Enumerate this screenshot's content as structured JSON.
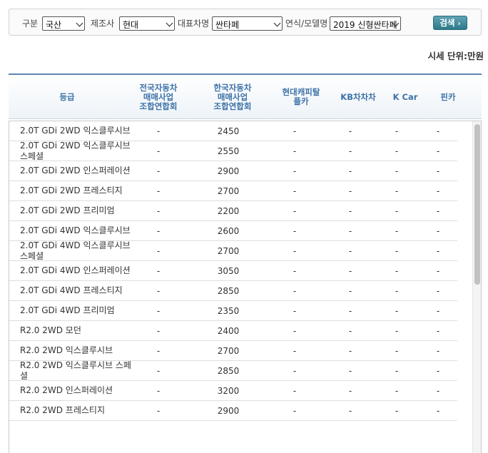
{
  "filters": {
    "category_label": "구분",
    "category_value": "국산",
    "maker_label": "제조사",
    "maker_value": "현대",
    "model_label": "대표차명",
    "model_value": "싼타페",
    "year_label": "연식/모델명",
    "year_value": "2019 신형싼타페",
    "search_label": "검색",
    "search_icon": "chevron-right-icon"
  },
  "unit_note": "시세 단위:만원",
  "columns": {
    "grade": "등급",
    "c1": [
      "전국자동차",
      "매매사업",
      "조합연합회"
    ],
    "c2": [
      "한국자동차",
      "매매사업",
      "조합연합회"
    ],
    "c3": [
      "현대캐피탈",
      "플카"
    ],
    "c4": "KB차차차",
    "c5": "K Car",
    "c6": "핀카"
  },
  "accent_color": "#3d72a8",
  "rows": [
    {
      "grade": "2.0T GDi 2WD 익스클루시브",
      "v": [
        "-",
        "2450",
        "-",
        "-",
        "-",
        "-"
      ]
    },
    {
      "grade": "2.0T GDi 2WD 익스클루시브 스페셜",
      "v": [
        "-",
        "2550",
        "-",
        "-",
        "-",
        "-"
      ]
    },
    {
      "grade": "2.0T GDi 2WD 인스퍼레이션",
      "v": [
        "-",
        "2900",
        "-",
        "-",
        "-",
        "-"
      ]
    },
    {
      "grade": "2.0T GDi 2WD 프레스티지",
      "v": [
        "-",
        "2700",
        "-",
        "-",
        "-",
        "-"
      ]
    },
    {
      "grade": "2.0T GDi 2WD 프리미엄",
      "v": [
        "-",
        "2200",
        "-",
        "-",
        "-",
        "-"
      ]
    },
    {
      "grade": "2.0T GDi 4WD 익스클루시브",
      "v": [
        "-",
        "2600",
        "-",
        "-",
        "-",
        "-"
      ]
    },
    {
      "grade": "2.0T GDi 4WD 익스클루시브 스페셜",
      "v": [
        "-",
        "2700",
        "-",
        "-",
        "-",
        "-"
      ]
    },
    {
      "grade": "2.0T GDi 4WD 인스퍼레이션",
      "v": [
        "-",
        "3050",
        "-",
        "-",
        "-",
        "-"
      ]
    },
    {
      "grade": "2.0T GDi 4WD 프레스티지",
      "v": [
        "-",
        "2850",
        "-",
        "-",
        "-",
        "-"
      ]
    },
    {
      "grade": "2.0T GDi 4WD 프리미엄",
      "v": [
        "-",
        "2350",
        "-",
        "-",
        "-",
        "-"
      ]
    },
    {
      "grade": "R2.0 2WD 모던",
      "v": [
        "-",
        "2400",
        "-",
        "-",
        "-",
        "-"
      ]
    },
    {
      "grade": "R2.0 2WD 익스클루시브",
      "v": [
        "-",
        "2700",
        "-",
        "-",
        "-",
        "-"
      ]
    },
    {
      "grade": "R2.0 2WD 익스클루시브 스페셜",
      "v": [
        "-",
        "2850",
        "-",
        "-",
        "-",
        "-"
      ]
    },
    {
      "grade": "R2.0 2WD 인스퍼레이션",
      "v": [
        "-",
        "3200",
        "-",
        "-",
        "-",
        "-"
      ]
    },
    {
      "grade": "R2.0 2WD 프레스티지",
      "v": [
        "-",
        "2900",
        "-",
        "-",
        "-",
        "-"
      ]
    }
  ]
}
